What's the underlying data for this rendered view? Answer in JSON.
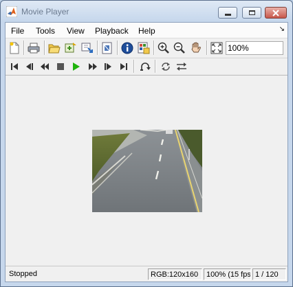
{
  "window": {
    "title": "Movie Player"
  },
  "menu": {
    "items": [
      "File",
      "Tools",
      "View",
      "Playback",
      "Help"
    ]
  },
  "toolbar": {
    "zoom_value": "100%",
    "icons": [
      "new-window-icon",
      "print-icon",
      "open-file-icon",
      "connect-simulink-icon",
      "export-icon",
      "media-info-icon",
      "video-info-icon",
      "zoom-in-icon",
      "zoom-out-icon",
      "pan-hand-icon",
      "fit-to-window-icon"
    ]
  },
  "playback": {
    "icons": [
      "go-to-first-icon",
      "step-back-icon",
      "rewind-icon",
      "stop-icon",
      "play-icon",
      "fast-forward-icon",
      "step-forward-icon",
      "go-to-last-icon",
      "jump-to-icon",
      "repeat-icon",
      "autoreverse-icon"
    ],
    "play_color": "#1fb30c"
  },
  "status": {
    "state": "Stopped",
    "format": "RGB:120x160",
    "rate": "100% (15 fps)",
    "frame": "1 / 120"
  }
}
